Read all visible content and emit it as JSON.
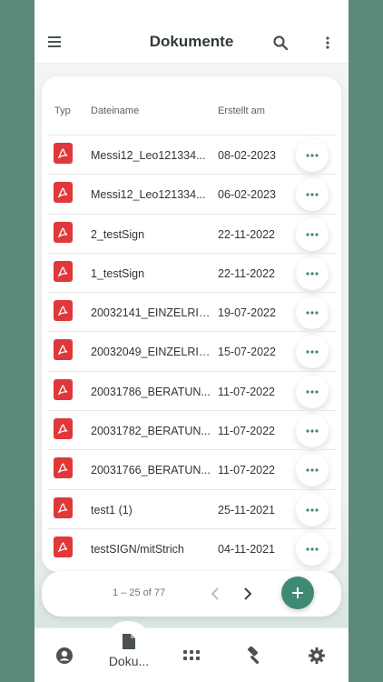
{
  "appbar": {
    "title": "Dokumente"
  },
  "table": {
    "headers": {
      "type": "Typ",
      "name": "Dateiname",
      "date": "Erstellt am"
    },
    "rows": [
      {
        "name": "Messi12_Leo121334...",
        "date": "08-02-2023"
      },
      {
        "name": "Messi12_Leo121334...",
        "date": "06-02-2023"
      },
      {
        "name": "2_testSign",
        "date": "22-11-2022"
      },
      {
        "name": "1_testSign",
        "date": "22-11-2022"
      },
      {
        "name": "20032141_EINZELRIS...",
        "date": "19-07-2022"
      },
      {
        "name": "20032049_EINZELRIS...",
        "date": "15-07-2022"
      },
      {
        "name": "20031786_BERATUN...",
        "date": "11-07-2022"
      },
      {
        "name": "20031782_BERATUN...",
        "date": "11-07-2022"
      },
      {
        "name": "20031766_BERATUN...",
        "date": "11-07-2022"
      },
      {
        "name": "test1 (1)",
        "date": "25-11-2021"
      },
      {
        "name": "testSIGN/mitStrich",
        "date": "04-11-2021"
      }
    ]
  },
  "pager": {
    "range": "1 – 25 of 77"
  },
  "bottom_nav": {
    "active_label": "Doku..."
  },
  "colors": {
    "accent": "#3f8a75",
    "pdf": "#e0383a",
    "background": "#5b8a78"
  }
}
